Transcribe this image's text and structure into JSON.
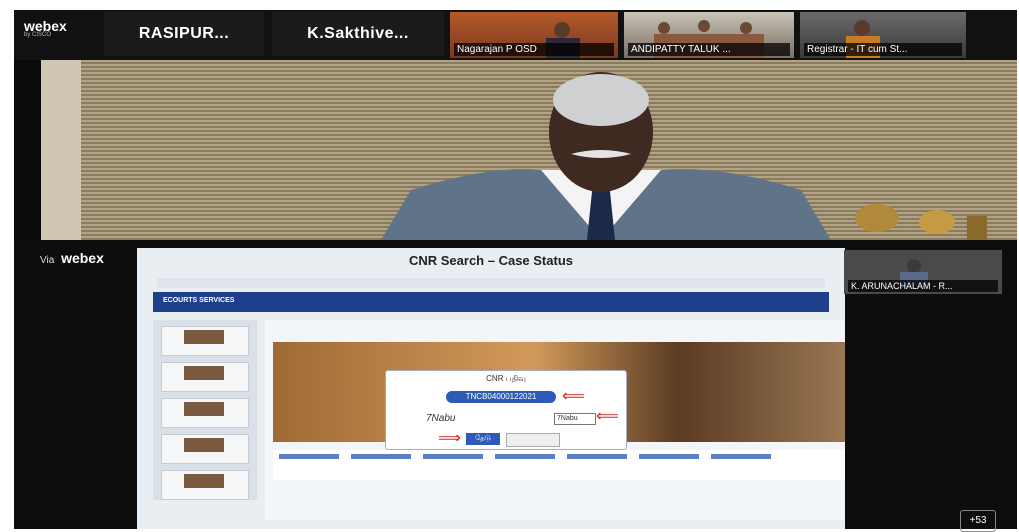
{
  "app": {
    "logo_text": "webex",
    "logo_sub": "by CISCO"
  },
  "participants": [
    {
      "name": "RASIPUR..."
    },
    {
      "name": "K.Sakthive..."
    },
    {
      "name": "Nagarajan P OSD"
    },
    {
      "name": "ANDIPATTY TALUK ..."
    },
    {
      "name": "Registrar - IT cum St..."
    }
  ],
  "share": {
    "via_label": "Via",
    "via_brand": "webex",
    "window_title": "CNR Search – Case Status",
    "site_brand": "ECOURTS SERVICES",
    "dialog_title": "CNR பதிவு",
    "cnr_value": "TNCB04000122021",
    "captcha_text": "7Nabu",
    "captcha_input": "7Nabu",
    "search_button": "தேடு"
  },
  "pip": {
    "name": "K. ARUNACHALAM - R..."
  },
  "more_participants": "+53",
  "colors": {
    "accent": "#2d5bb5",
    "nav": "#1d3f8c",
    "arrow": "#d22222"
  }
}
